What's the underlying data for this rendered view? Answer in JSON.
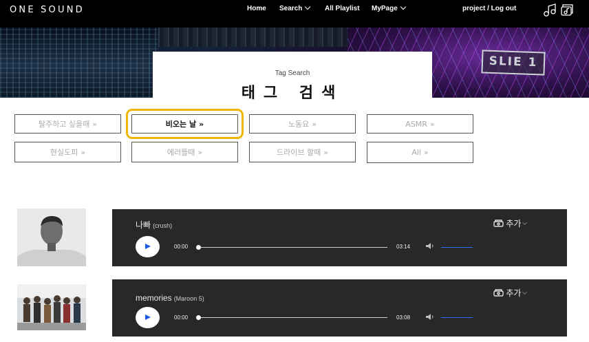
{
  "brand": "ONE SOUND",
  "nav": {
    "home": "Home",
    "search": "Search",
    "all_playlist": "All Playlist",
    "mypage": "MyPage",
    "account": "project / Log out"
  },
  "page": {
    "subtitle": "Tag Search",
    "title": "태그 검색"
  },
  "banner": {
    "sign_text": "SLIE 1"
  },
  "tags": [
    {
      "label": "탈주하고 싶을때",
      "selected": false
    },
    {
      "label": "비오는 날",
      "selected": true
    },
    {
      "label": "노동요",
      "selected": false
    },
    {
      "label": "ASMR",
      "selected": false
    },
    {
      "label": "현실도피",
      "selected": false
    },
    {
      "label": "에러뜰때",
      "selected": false
    },
    {
      "label": "드라이브 할때",
      "selected": false
    },
    {
      "label": "All",
      "selected": false
    }
  ],
  "tag_arrow": "»",
  "tracks": [
    {
      "title": "나빠",
      "artist": "(crush)",
      "current_time": "00:00",
      "duration": "03:14",
      "add_label": "추가"
    },
    {
      "title": "memories",
      "artist": "(Maroon 5)",
      "current_time": "00:00",
      "duration": "03:08",
      "add_label": "추가"
    }
  ],
  "colors": {
    "highlight": "#f2b705",
    "player_bg": "#282828",
    "accent_blue": "#2f6bff"
  },
  "icons": [
    "music-notes-icon",
    "chevron-down-icon",
    "music-folder-icon",
    "play-icon",
    "volume-icon"
  ]
}
